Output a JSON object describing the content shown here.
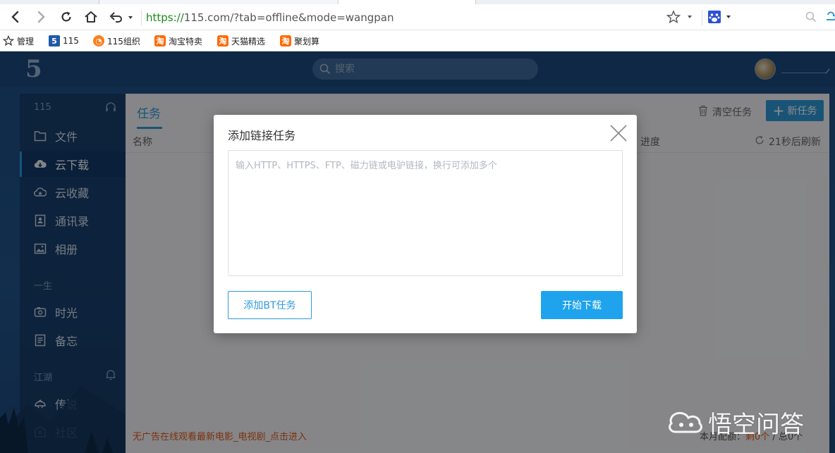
{
  "browser": {
    "url_scheme": "https://",
    "url_rest": "115.com/?tab=offline&mode=wangpan",
    "bookmarks": [
      {
        "label": "管理",
        "icon": "star-icon"
      },
      {
        "label": "115",
        "icon": "115-logo-icon",
        "glyph": "5"
      },
      {
        "label": "115组织",
        "icon": "115-org-icon",
        "glyph": "◔"
      },
      {
        "label": "淘宝特卖",
        "icon": "taobao-icon",
        "glyph": "淘"
      },
      {
        "label": "天猫精选",
        "icon": "taobao-icon",
        "glyph": "淘"
      },
      {
        "label": "聚划算",
        "icon": "taobao-icon",
        "glyph": "淘"
      }
    ]
  },
  "app": {
    "logo": "5",
    "search_placeholder": "搜索",
    "sidebar": {
      "section_115": "115",
      "items_top": [
        {
          "label": "文件",
          "icon": "folder-icon"
        },
        {
          "label": "云下载",
          "icon": "cloud-download-icon",
          "active": true
        },
        {
          "label": "云收藏",
          "icon": "cloud-favorite-icon"
        },
        {
          "label": "通讯录",
          "icon": "contacts-icon"
        },
        {
          "label": "相册",
          "icon": "photo-album-icon"
        }
      ],
      "section_life": "一生",
      "items_life": [
        {
          "label": "时光",
          "icon": "time-icon"
        },
        {
          "label": "备忘",
          "icon": "memo-icon"
        }
      ],
      "section_jianghu": "江湖",
      "items_jianghu": [
        {
          "label": "传说",
          "icon": "legend-icon"
        },
        {
          "label": "社区",
          "icon": "community-icon"
        }
      ]
    },
    "main": {
      "tab": "任务",
      "clear_label": "清空任务",
      "new_label": "新任务",
      "col_name": "名称",
      "col_progress": "进度",
      "refresh_label": "21秒后刷新",
      "promo": "无广告在线观看最新电影_电视剧_点击进入",
      "quota_prefix": "本月配额：",
      "quota_value": "剩0个",
      "quota_suffix": " / 总0个"
    }
  },
  "dialog": {
    "title": "添加链接任务",
    "placeholder": "输入HTTP、HTTPS、FTP、磁力链或电驴链接，换行可添加多个",
    "bt_button": "添加BT任务",
    "start_button": "开始下载"
  },
  "watermark": "悟空问答"
}
